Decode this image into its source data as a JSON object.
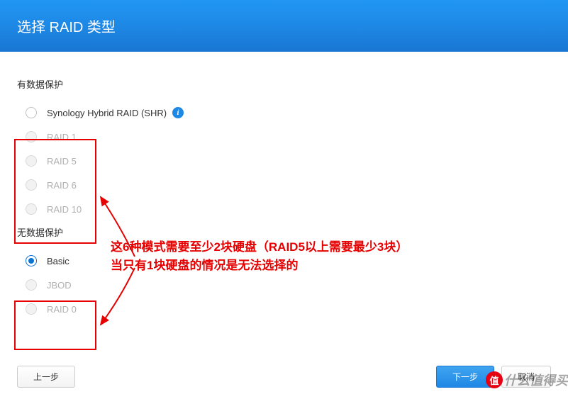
{
  "header": {
    "title": "选择 RAID 类型"
  },
  "sections": {
    "protected": {
      "title": "有数据保护",
      "options": [
        {
          "label": "Synology Hybrid RAID (SHR)",
          "disabled": false,
          "selected": false,
          "info": true
        },
        {
          "label": "RAID 1",
          "disabled": true,
          "selected": false
        },
        {
          "label": "RAID 5",
          "disabled": true,
          "selected": false
        },
        {
          "label": "RAID 6",
          "disabled": true,
          "selected": false
        },
        {
          "label": "RAID 10",
          "disabled": true,
          "selected": false
        }
      ]
    },
    "unprotected": {
      "title": "无数据保护",
      "options": [
        {
          "label": "Basic",
          "disabled": false,
          "selected": true
        },
        {
          "label": "JBOD",
          "disabled": true,
          "selected": false
        },
        {
          "label": "RAID 0",
          "disabled": true,
          "selected": false
        }
      ]
    }
  },
  "annotation": {
    "line1": "这6种模式需要至少2块硬盘（RAID5以上需要最少3块）",
    "line2": "当只有1块硬盘的情况是无法选择的"
  },
  "footer": {
    "back": "上一步",
    "next": "下一步",
    "cancel": "取消"
  },
  "watermark": {
    "badge": "值",
    "text": "什么值得买"
  },
  "info_glyph": "i"
}
